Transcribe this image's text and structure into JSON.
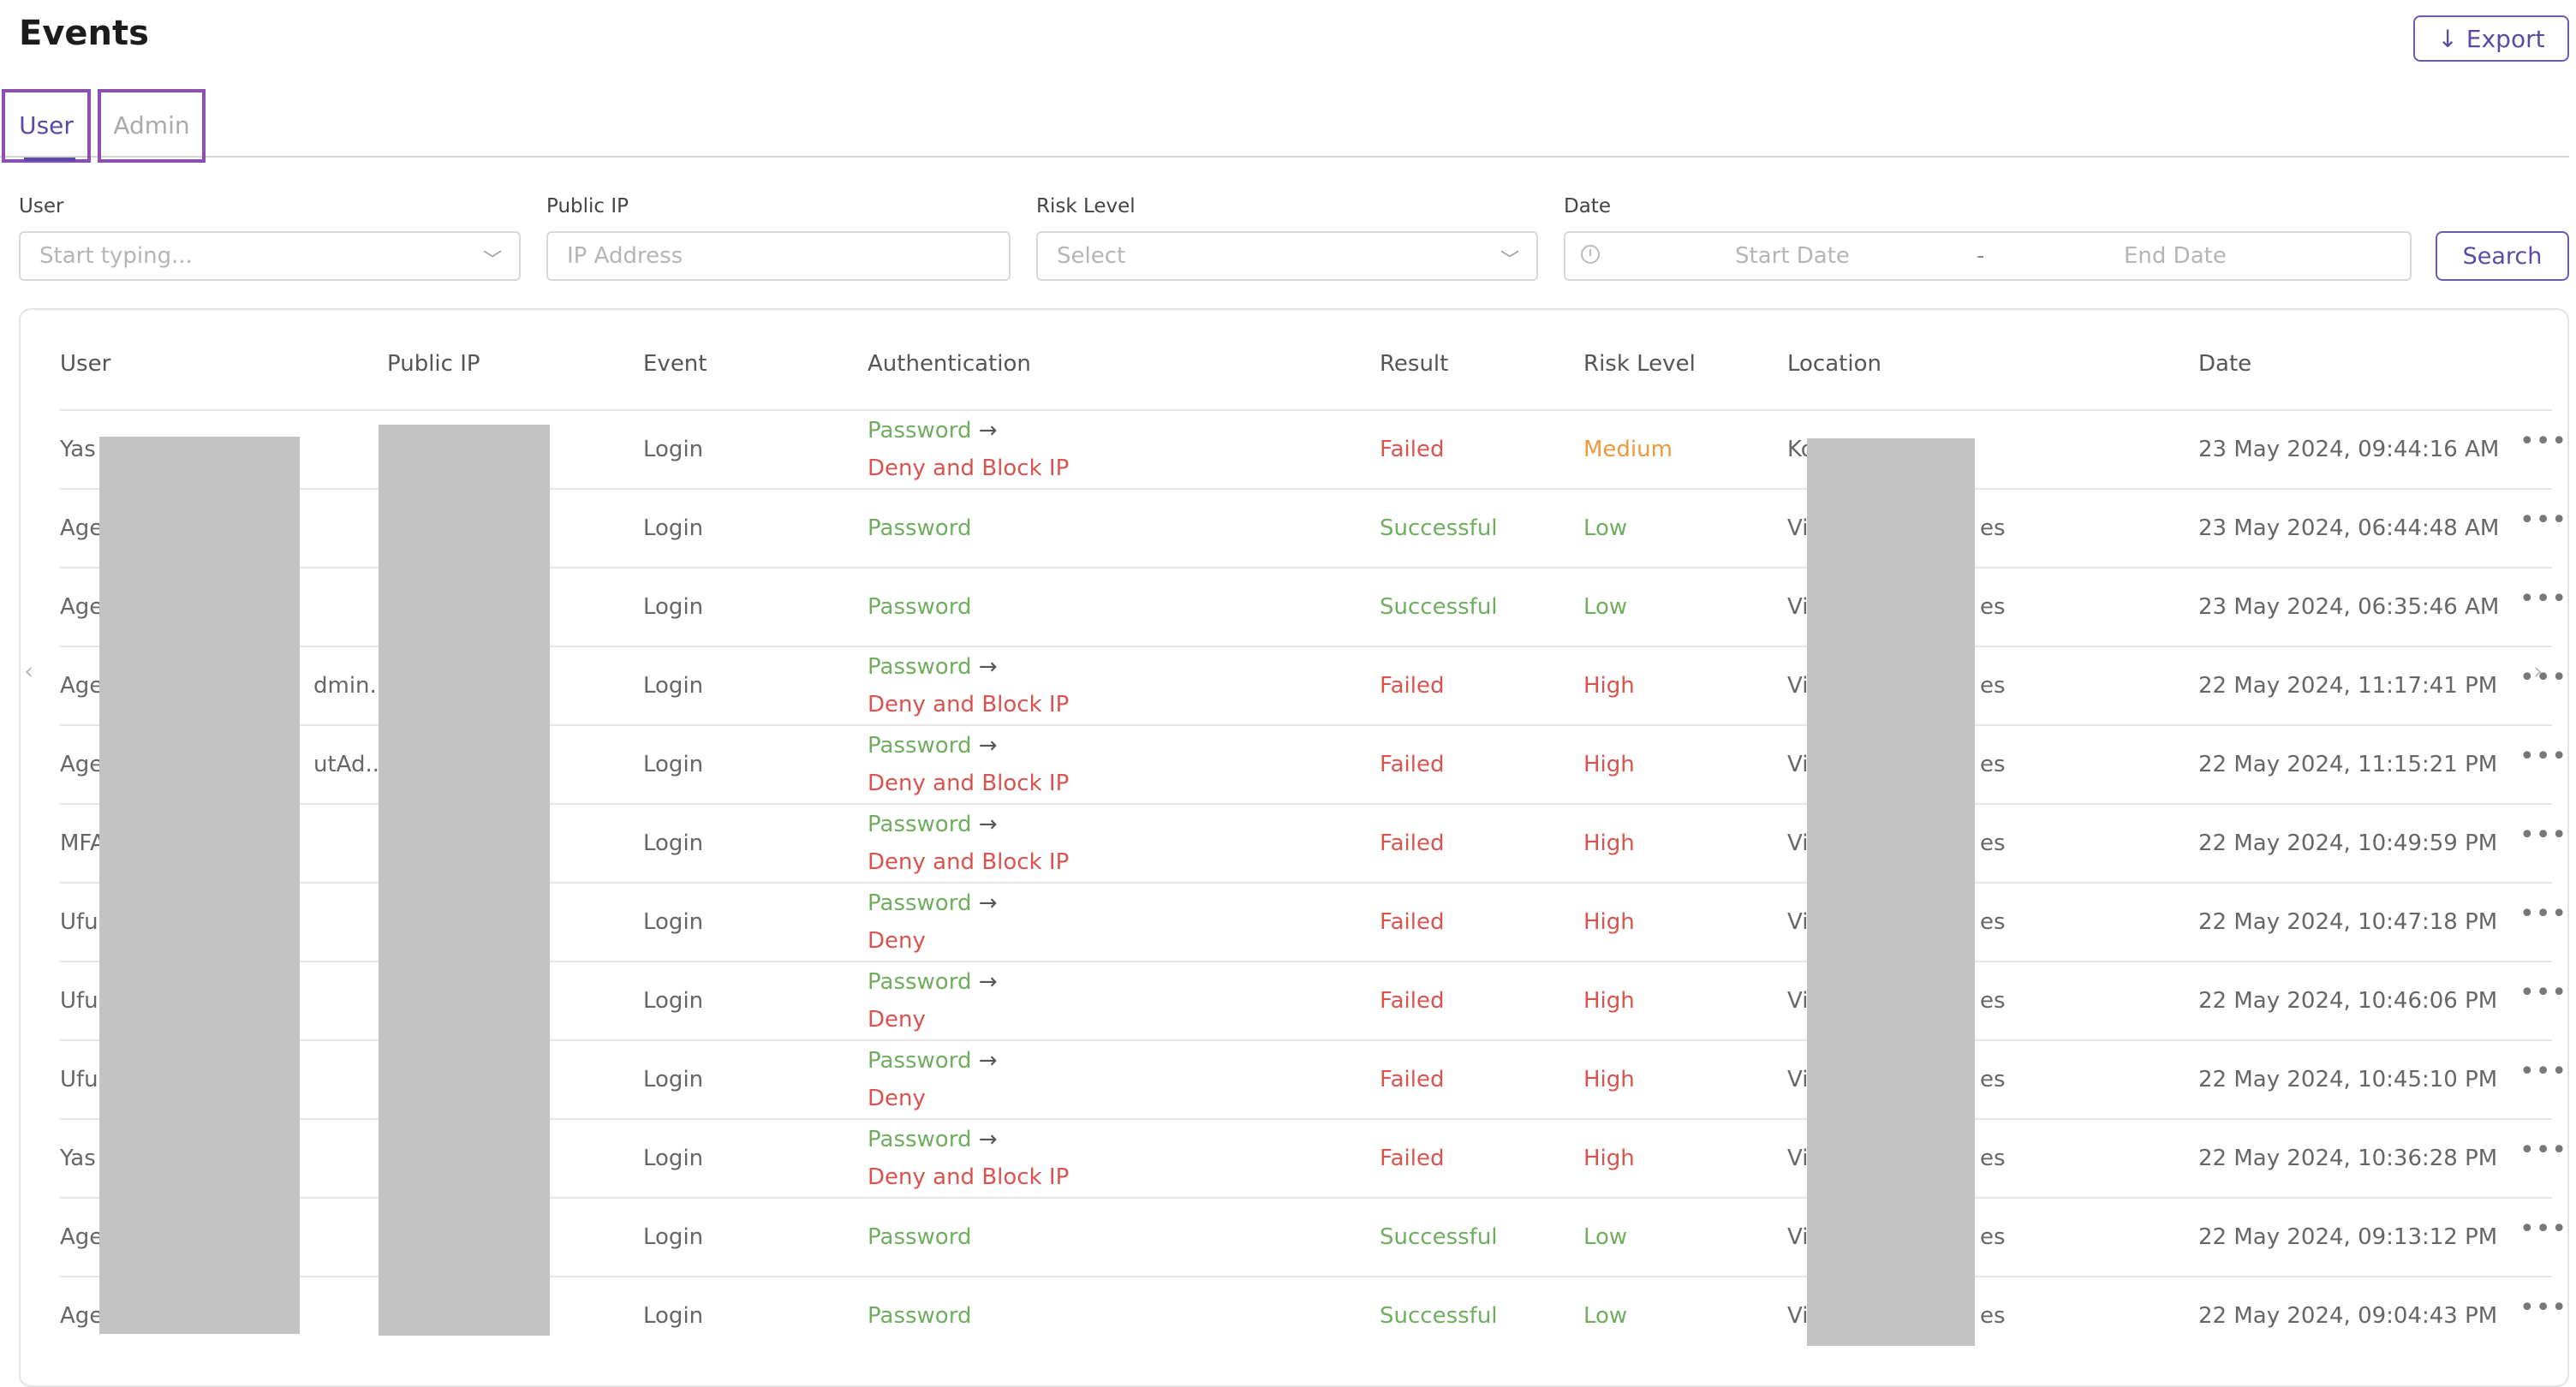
{
  "page": {
    "title": "Events",
    "export_label": "Export"
  },
  "tabs": [
    {
      "label": "User"
    },
    {
      "label": "Admin"
    }
  ],
  "filters": {
    "user": {
      "label": "User",
      "placeholder": "Start typing..."
    },
    "public_ip": {
      "label": "Public IP",
      "placeholder": "IP Address"
    },
    "risk_level": {
      "label": "Risk Level",
      "placeholder": "Select"
    },
    "date": {
      "label": "Date",
      "start_placeholder": "Start Date",
      "separator": "-",
      "end_placeholder": "End Date"
    },
    "search_label": "Search"
  },
  "table": {
    "columns": [
      "User",
      "Public IP",
      "Event",
      "Authentication",
      "Result",
      "Risk Level",
      "Location",
      "Date"
    ],
    "rows": [
      {
        "user": "Yas",
        "event": "Login",
        "auth_main": "Password",
        "auth_action": "Deny and Block IP",
        "result": "Failed",
        "risk": "Medium",
        "loc_prefix": "Koc",
        "loc_suffix": "",
        "date": "23 May 2024, 09:44:16 AM"
      },
      {
        "user": "Age",
        "event": "Login",
        "auth_main": "Password",
        "auth_action": "",
        "result": "Successful",
        "risk": "Low",
        "loc_prefix": "Virg",
        "loc_suffix": "es",
        "date": "23 May 2024, 06:44:48 AM"
      },
      {
        "user": "Age",
        "event": "Login",
        "auth_main": "Password",
        "auth_action": "",
        "result": "Successful",
        "risk": "Low",
        "loc_prefix": "Virg",
        "loc_suffix": "es",
        "date": "23 May 2024, 06:35:46 AM"
      },
      {
        "user": "Age",
        "user_suffix": "dmin...",
        "event": "Login",
        "auth_main": "Password",
        "auth_action": "Deny and Block IP",
        "result": "Failed",
        "risk": "High",
        "loc_prefix": "Virg",
        "loc_suffix": "es",
        "date": "22 May 2024, 11:17:41 PM"
      },
      {
        "user": "Age",
        "user_suffix": "utAd...",
        "event": "Login",
        "auth_main": "Password",
        "auth_action": "Deny and Block IP",
        "result": "Failed",
        "risk": "High",
        "loc_prefix": "Virg",
        "loc_suffix": "es",
        "date": "22 May 2024, 11:15:21 PM"
      },
      {
        "user": "MFA",
        "event": "Login",
        "auth_main": "Password",
        "auth_action": "Deny and Block IP",
        "result": "Failed",
        "risk": "High",
        "loc_prefix": "Virg",
        "loc_suffix": "es",
        "date": "22 May 2024, 10:49:59 PM"
      },
      {
        "user": "Uful",
        "event": "Login",
        "auth_main": "Password",
        "auth_action": "Deny",
        "result": "Failed",
        "risk": "High",
        "loc_prefix": "Virg",
        "loc_suffix": "es",
        "date": "22 May 2024, 10:47:18 PM"
      },
      {
        "user": "Uful",
        "event": "Login",
        "auth_main": "Password",
        "auth_action": "Deny",
        "result": "Failed",
        "risk": "High",
        "loc_prefix": "Virg",
        "loc_suffix": "es",
        "date": "22 May 2024, 10:46:06 PM"
      },
      {
        "user": "Uful",
        "event": "Login",
        "auth_main": "Password",
        "auth_action": "Deny",
        "result": "Failed",
        "risk": "High",
        "loc_prefix": "Virg",
        "loc_suffix": "es",
        "date": "22 May 2024, 10:45:10 PM"
      },
      {
        "user": "Yas",
        "event": "Login",
        "auth_main": "Password",
        "auth_action": "Deny and Block IP",
        "result": "Failed",
        "risk": "High",
        "loc_prefix": "Virg",
        "loc_suffix": "es",
        "date": "22 May 2024, 10:36:28 PM"
      },
      {
        "user": "Age",
        "event": "Login",
        "auth_main": "Password",
        "auth_action": "",
        "result": "Successful",
        "risk": "Low",
        "loc_prefix": "Virg",
        "loc_suffix": "es",
        "date": "22 May 2024, 09:13:12 PM"
      },
      {
        "user": "Age",
        "event": "Login",
        "auth_main": "Password",
        "auth_action": "",
        "result": "Successful",
        "risk": "Low",
        "loc_prefix": "Virg",
        "loc_suffix": "es",
        "date": "22 May 2024, 09:04:43 PM"
      }
    ]
  },
  "colors": {
    "accent": "#5b4aa5",
    "tab_highlight": "#8a4fb0",
    "success": "#6fae5e",
    "danger": "#d9534f",
    "warning": "#ec9a3c"
  },
  "icons": {
    "export": "arrow-down-icon",
    "dropdown": "chevron-down-icon",
    "date": "clock-icon",
    "row_menu": "more-horizontal-icon",
    "auth_next": "arrow-right-icon"
  }
}
